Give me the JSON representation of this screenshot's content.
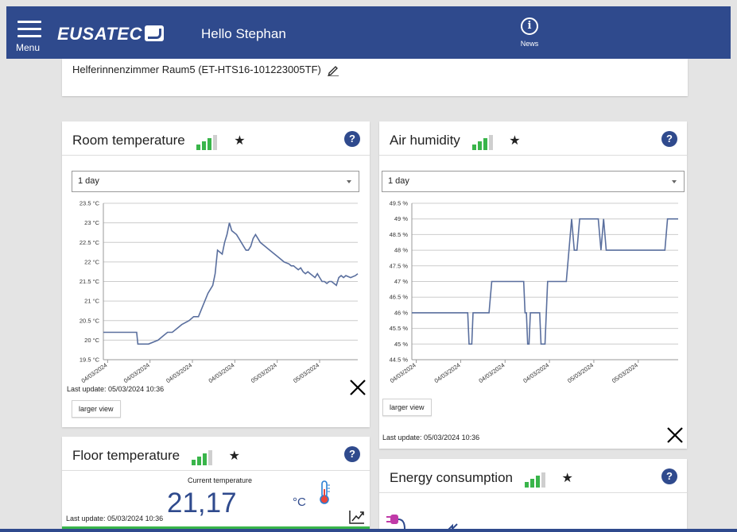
{
  "header": {
    "menu_label": "Menu",
    "logo_text": "EUSATEC",
    "greeting": "Hello Stephan",
    "news_label": "News"
  },
  "device": {
    "name": "Helferinnenzimmer Raum5 (ET-HTS16-101223005TF)"
  },
  "colors": {
    "brand": "#2f4a8d",
    "signal_on": "#39b54a",
    "signal_off": "#cfcfcf",
    "chart_line": "#5a6f9e"
  },
  "room_temperature": {
    "title": "Room temperature",
    "range": "1 day",
    "larger_view": "larger view",
    "last_update": "Last update: 05/03/2024 10:36"
  },
  "air_humidity": {
    "title": "Air humidity",
    "range": "1 day",
    "larger_view": "larger view",
    "last_update": "Last update: 05/03/2024 10:36"
  },
  "floor_temperature": {
    "title": "Floor temperature",
    "current_label": "Current temperature",
    "value": "21,17",
    "unit": "°C",
    "last_update": "Last update: 05/03/2024 10:36"
  },
  "energy": {
    "title": "Energy consumption"
  },
  "chart_data": [
    {
      "type": "line",
      "ylim": [
        19.5,
        23.5
      ],
      "yticks": [
        "19.5 °C",
        "20 °C",
        "20.5 °C",
        "21 °C",
        "21.5 °C",
        "22 °C",
        "22.5 °C",
        "23 °C",
        "23.5 °C"
      ],
      "xticks": [
        "04/03/2024",
        "04/03/2024",
        "04/03/2024",
        "04/03/2024",
        "05/03/2024",
        "05/03/2024"
      ],
      "grid": true,
      "points": [
        [
          0,
          20.2
        ],
        [
          0.14,
          20.2
        ],
        [
          0.145,
          19.9
        ],
        [
          0.19,
          19.9
        ],
        [
          0.23,
          20.0
        ],
        [
          0.25,
          20.1
        ],
        [
          0.27,
          20.2
        ],
        [
          0.29,
          20.2
        ],
        [
          0.31,
          20.3
        ],
        [
          0.33,
          20.4
        ],
        [
          0.36,
          20.5
        ],
        [
          0.38,
          20.6
        ],
        [
          0.4,
          20.6
        ],
        [
          0.42,
          20.9
        ],
        [
          0.44,
          21.2
        ],
        [
          0.46,
          21.4
        ],
        [
          0.47,
          21.7
        ],
        [
          0.48,
          22.3
        ],
        [
          0.5,
          22.2
        ],
        [
          0.51,
          22.5
        ],
        [
          0.52,
          22.7
        ],
        [
          0.53,
          23.0
        ],
        [
          0.54,
          22.8
        ],
        [
          0.56,
          22.7
        ],
        [
          0.57,
          22.6
        ],
        [
          0.58,
          22.5
        ],
        [
          0.59,
          22.4
        ],
        [
          0.6,
          22.3
        ],
        [
          0.61,
          22.3
        ],
        [
          0.62,
          22.4
        ],
        [
          0.63,
          22.6
        ],
        [
          0.64,
          22.7
        ],
        [
          0.65,
          22.6
        ],
        [
          0.66,
          22.5
        ],
        [
          0.68,
          22.4
        ],
        [
          0.7,
          22.3
        ],
        [
          0.72,
          22.2
        ],
        [
          0.74,
          22.1
        ],
        [
          0.76,
          22.0
        ],
        [
          0.78,
          21.95
        ],
        [
          0.79,
          21.9
        ],
        [
          0.8,
          21.9
        ],
        [
          0.81,
          21.85
        ],
        [
          0.82,
          21.8
        ],
        [
          0.83,
          21.85
        ],
        [
          0.84,
          21.75
        ],
        [
          0.85,
          21.7
        ],
        [
          0.86,
          21.75
        ],
        [
          0.87,
          21.7
        ],
        [
          0.88,
          21.65
        ],
        [
          0.89,
          21.6
        ],
        [
          0.9,
          21.7
        ],
        [
          0.91,
          21.6
        ],
        [
          0.92,
          21.5
        ],
        [
          0.93,
          21.5
        ],
        [
          0.94,
          21.45
        ],
        [
          0.95,
          21.5
        ],
        [
          0.96,
          21.5
        ],
        [
          0.97,
          21.45
        ],
        [
          0.98,
          21.4
        ],
        [
          0.99,
          21.6
        ],
        [
          1.0,
          21.65
        ],
        [
          1.01,
          21.6
        ],
        [
          1.02,
          21.65
        ],
        [
          1.04,
          21.6
        ],
        [
          1.06,
          21.65
        ],
        [
          1.07,
          21.7
        ]
      ]
    },
    {
      "type": "line",
      "ylim": [
        44.5,
        49.5
      ],
      "yticks": [
        "44.5 %",
        "45 %",
        "45.5 %",
        "46 %",
        "46.5 %",
        "47 %",
        "47.5 %",
        "48 %",
        "48.5 %",
        "49 %",
        "49.5 %"
      ],
      "xticks": [
        "04/03/2024",
        "04/03/2024",
        "04/03/2024",
        "04/03/2024",
        "05/03/2024",
        "05/03/2024"
      ],
      "grid": true,
      "points": [
        [
          0,
          46
        ],
        [
          0.21,
          46
        ],
        [
          0.215,
          45
        ],
        [
          0.225,
          45
        ],
        [
          0.23,
          46
        ],
        [
          0.29,
          46
        ],
        [
          0.3,
          47
        ],
        [
          0.42,
          47
        ],
        [
          0.425,
          46
        ],
        [
          0.43,
          46
        ],
        [
          0.435,
          45
        ],
        [
          0.44,
          45
        ],
        [
          0.445,
          46
        ],
        [
          0.48,
          46
        ],
        [
          0.485,
          45
        ],
        [
          0.5,
          45
        ],
        [
          0.51,
          47
        ],
        [
          0.58,
          47
        ],
        [
          0.6,
          49
        ],
        [
          0.61,
          48
        ],
        [
          0.62,
          48
        ],
        [
          0.63,
          49
        ],
        [
          0.7,
          49
        ],
        [
          0.71,
          48
        ],
        [
          0.72,
          49
        ],
        [
          0.73,
          48
        ],
        [
          0.95,
          48
        ],
        [
          0.96,
          49
        ],
        [
          1.0,
          49
        ]
      ]
    }
  ]
}
